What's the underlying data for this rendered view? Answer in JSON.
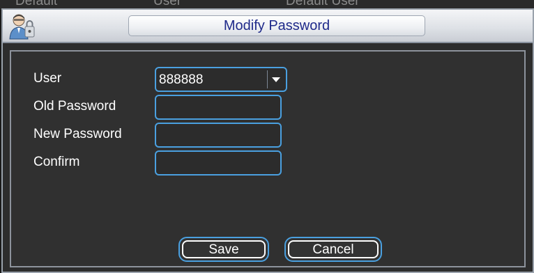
{
  "background": {
    "fragments": [
      "Default",
      "User",
      "Default User"
    ]
  },
  "dialog": {
    "title": "Modify Password",
    "icon": "user-lock-icon",
    "fields": {
      "user_label": "User",
      "user_value": "888888",
      "old_password_label": "Old Password",
      "old_password_value": "",
      "new_password_label": "New Password",
      "new_password_value": "",
      "confirm_label": "Confirm",
      "confirm_value": ""
    },
    "buttons": {
      "save": "Save",
      "cancel": "Cancel"
    }
  },
  "colors": {
    "title_text": "#1f2a8a",
    "field_border": "#4aa0e0",
    "panel_bg": "#303030"
  }
}
